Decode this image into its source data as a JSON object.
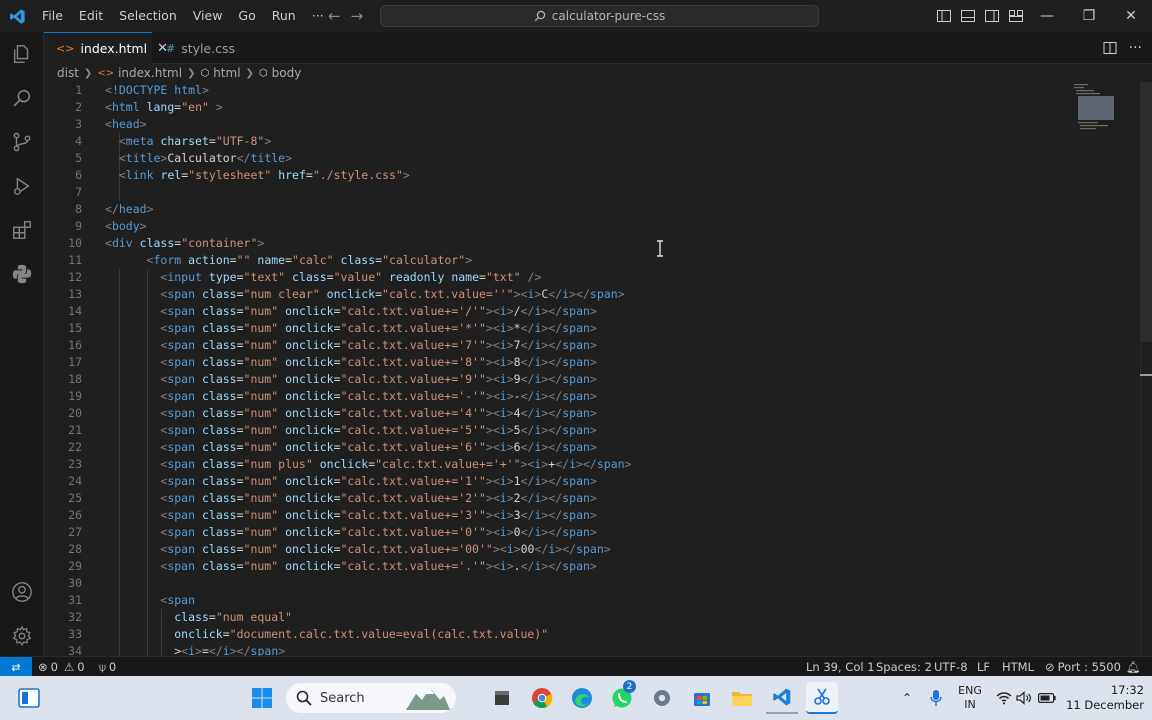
{
  "titlebar": {
    "menu": [
      "File",
      "Edit",
      "Selection",
      "View",
      "Go",
      "Run",
      "···"
    ],
    "search": "calculator-pure-css"
  },
  "tabs": [
    {
      "label": "index.html",
      "icon": "<>",
      "active": true
    },
    {
      "label": "style.css",
      "icon": "#",
      "active": false
    }
  ],
  "breadcrumb": [
    "dist",
    "index.html",
    "html",
    "body"
  ],
  "editor": {
    "lines": [
      {
        "n": "1"
      },
      {
        "n": "2"
      },
      {
        "n": "3"
      },
      {
        "n": "4"
      },
      {
        "n": "5"
      },
      {
        "n": "6"
      },
      {
        "n": "7"
      },
      {
        "n": "8"
      },
      {
        "n": "9"
      },
      {
        "n": "10"
      },
      {
        "n": "11"
      },
      {
        "n": "12"
      },
      {
        "n": "13"
      },
      {
        "n": "14"
      },
      {
        "n": "15"
      },
      {
        "n": "16"
      },
      {
        "n": "17"
      },
      {
        "n": "18"
      },
      {
        "n": "19"
      },
      {
        "n": "20"
      },
      {
        "n": "21"
      },
      {
        "n": "22"
      },
      {
        "n": "23"
      },
      {
        "n": "24"
      },
      {
        "n": "25"
      },
      {
        "n": "26"
      },
      {
        "n": "27"
      },
      {
        "n": "28"
      },
      {
        "n": "29"
      },
      {
        "n": "30"
      },
      {
        "n": "31"
      },
      {
        "n": "32"
      },
      {
        "n": "33"
      },
      {
        "n": "34"
      }
    ],
    "code": [
      "<!DOCTYPE html>",
      "<html lang=\"en\" >",
      "<head>",
      "  <meta charset=\"UTF-8\">",
      "  <title>Calculator</title>",
      "  <link rel=\"stylesheet\" href=\"./style.css\">",
      "",
      "</head>",
      "<body>",
      "<div class=\"container\">",
      "      <form action=\"\" name=\"calc\" class=\"calculator\">",
      "        <input type=\"text\" class=\"value\" readonly name=\"txt\" />",
      "        <span class=\"num clear\" onclick=\"calc.txt.value=''\"><i>C</i></span>",
      "        <span class=\"num\" onclick=\"calc.txt.value+='/'\"><i>/</i></span>",
      "        <span class=\"num\" onclick=\"calc.txt.value+='*'\"><i>*</i></span>",
      "        <span class=\"num\" onclick=\"calc.txt.value+='7'\"><i>7</i></span>",
      "        <span class=\"num\" onclick=\"calc.txt.value+='8'\"><i>8</i></span>",
      "        <span class=\"num\" onclick=\"calc.txt.value+='9'\"><i>9</i></span>",
      "        <span class=\"num\" onclick=\"calc.txt.value+='-'\"><i>-</i></span>",
      "        <span class=\"num\" onclick=\"calc.txt.value+='4'\"><i>4</i></span>",
      "        <span class=\"num\" onclick=\"calc.txt.value+='5'\"><i>5</i></span>",
      "        <span class=\"num\" onclick=\"calc.txt.value+='6'\"><i>6</i></span>",
      "        <span class=\"num plus\" onclick=\"calc.txt.value+='+'\"><i>+</i></span>",
      "        <span class=\"num\" onclick=\"calc.txt.value+='1'\"><i>1</i></span>",
      "        <span class=\"num\" onclick=\"calc.txt.value+='2'\"><i>2</i></span>",
      "        <span class=\"num\" onclick=\"calc.txt.value+='3'\"><i>3</i></span>",
      "        <span class=\"num\" onclick=\"calc.txt.value+='0'\"><i>0</i></span>",
      "        <span class=\"num\" onclick=\"calc.txt.value+='00'\"><i>00</i></span>",
      "        <span class=\"num\" onclick=\"calc.txt.value+='.'\"><i>.</i></span>",
      "",
      "        <span",
      "          class=\"num equal\"",
      "          onclick=\"document.calc.txt.value=eval(calc.txt.value)\"",
      "          ><i>=</i></span>"
    ]
  },
  "statusbar": {
    "errors": "0",
    "warnings": "0",
    "ports": "0",
    "position": "Ln 39, Col 1",
    "spaces": "Spaces: 2",
    "encoding": "UTF-8",
    "eol": "LF",
    "language": "HTML",
    "port": "Port : 5500"
  },
  "taskbar": {
    "search_label": "Search",
    "whatsapp_badge": "2",
    "lang_top": "ENG",
    "lang_bottom": "IN",
    "time": "17:32",
    "date": "11 December"
  },
  "colors": {
    "accent": "#0078d4",
    "tag": "#569cd6",
    "attribute": "#9cdcfe",
    "string": "#ce9178"
  }
}
